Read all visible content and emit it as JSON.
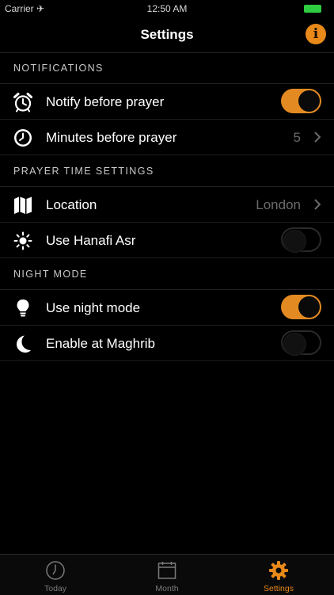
{
  "status_bar": {
    "carrier": "Carrier ✈",
    "time": "12:50 AM"
  },
  "header": {
    "title": "Settings",
    "info_label": "i"
  },
  "sections": [
    {
      "title": "NOTIFICATIONS",
      "rows": [
        {
          "label": "Notify before prayer",
          "type": "toggle",
          "on": true,
          "icon": "alarm-clock-icon"
        },
        {
          "label": "Minutes before prayer",
          "type": "disclosure",
          "value": "5",
          "icon": "stopwatch-icon"
        }
      ]
    },
    {
      "title": "PRAYER TIME SETTINGS",
      "rows": [
        {
          "label": "Location",
          "type": "disclosure",
          "value": "London",
          "icon": "map-icon"
        },
        {
          "label": "Use Hanafi Asr",
          "type": "toggle",
          "on": false,
          "icon": "sun-icon"
        }
      ]
    },
    {
      "title": "NIGHT MODE",
      "rows": [
        {
          "label": "Use night mode",
          "type": "toggle",
          "on": true,
          "icon": "lightbulb-icon"
        },
        {
          "label": "Enable at Maghrib",
          "type": "toggle",
          "on": false,
          "icon": "moon-icon"
        }
      ]
    }
  ],
  "tabs": [
    {
      "label": "Today",
      "icon": "clock-icon",
      "active": false
    },
    {
      "label": "Month",
      "icon": "calendar-icon",
      "active": false
    },
    {
      "label": "Settings",
      "icon": "gear-icon",
      "active": true
    }
  ],
  "colors": {
    "accent": "#e8891a",
    "background": "#000000",
    "muted": "#6b6b6b"
  }
}
